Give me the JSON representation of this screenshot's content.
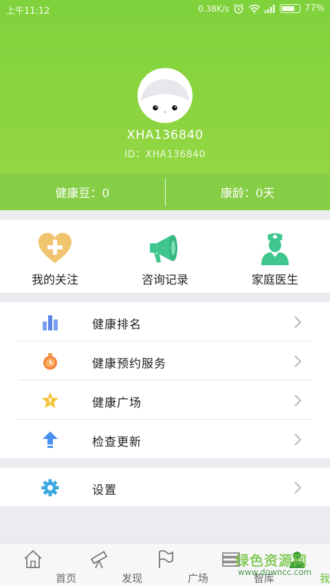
{
  "status_bar": {
    "time": "上午11:12",
    "network_speed": "0.38K/s",
    "battery": "77%",
    "battery_level": 0.77
  },
  "profile": {
    "username": "XHA136840",
    "user_id": "ID：XHA136840"
  },
  "stats": {
    "health_beans": "健康豆：0",
    "health_age": "康龄：0天"
  },
  "quick_actions": [
    {
      "label": "我的关注",
      "icon": "heart-plus-icon",
      "color": "#f0c46e"
    },
    {
      "label": "咨询记录",
      "icon": "megaphone-icon",
      "color": "#3fc78e"
    },
    {
      "label": "家庭医生",
      "icon": "nurse-icon",
      "color": "#3fc78e"
    }
  ],
  "menu": [
    {
      "label": "健康排名",
      "icon": "bar-chart-icon"
    },
    {
      "label": "健康预约服务",
      "icon": "stopwatch-icon"
    },
    {
      "label": "健康广场",
      "icon": "star-icon"
    },
    {
      "label": "检查更新",
      "icon": "upload-arrow-icon"
    }
  ],
  "settings": {
    "label": "设置",
    "icon": "gear-icon"
  },
  "tabs": [
    {
      "label": "首页",
      "icon": "home-icon"
    },
    {
      "label": "发现",
      "icon": "telescope-icon"
    },
    {
      "label": "广场",
      "icon": "flag-icon"
    },
    {
      "label": "智库",
      "icon": "books-icon"
    },
    {
      "label": "我的",
      "icon": "user-icon",
      "active": true
    }
  ],
  "watermark": {
    "text": "绿色资源网",
    "url": "www.downcc.com"
  },
  "colors": {
    "brand_green": "#7fd23c",
    "active_tab": "#6cc13b"
  }
}
